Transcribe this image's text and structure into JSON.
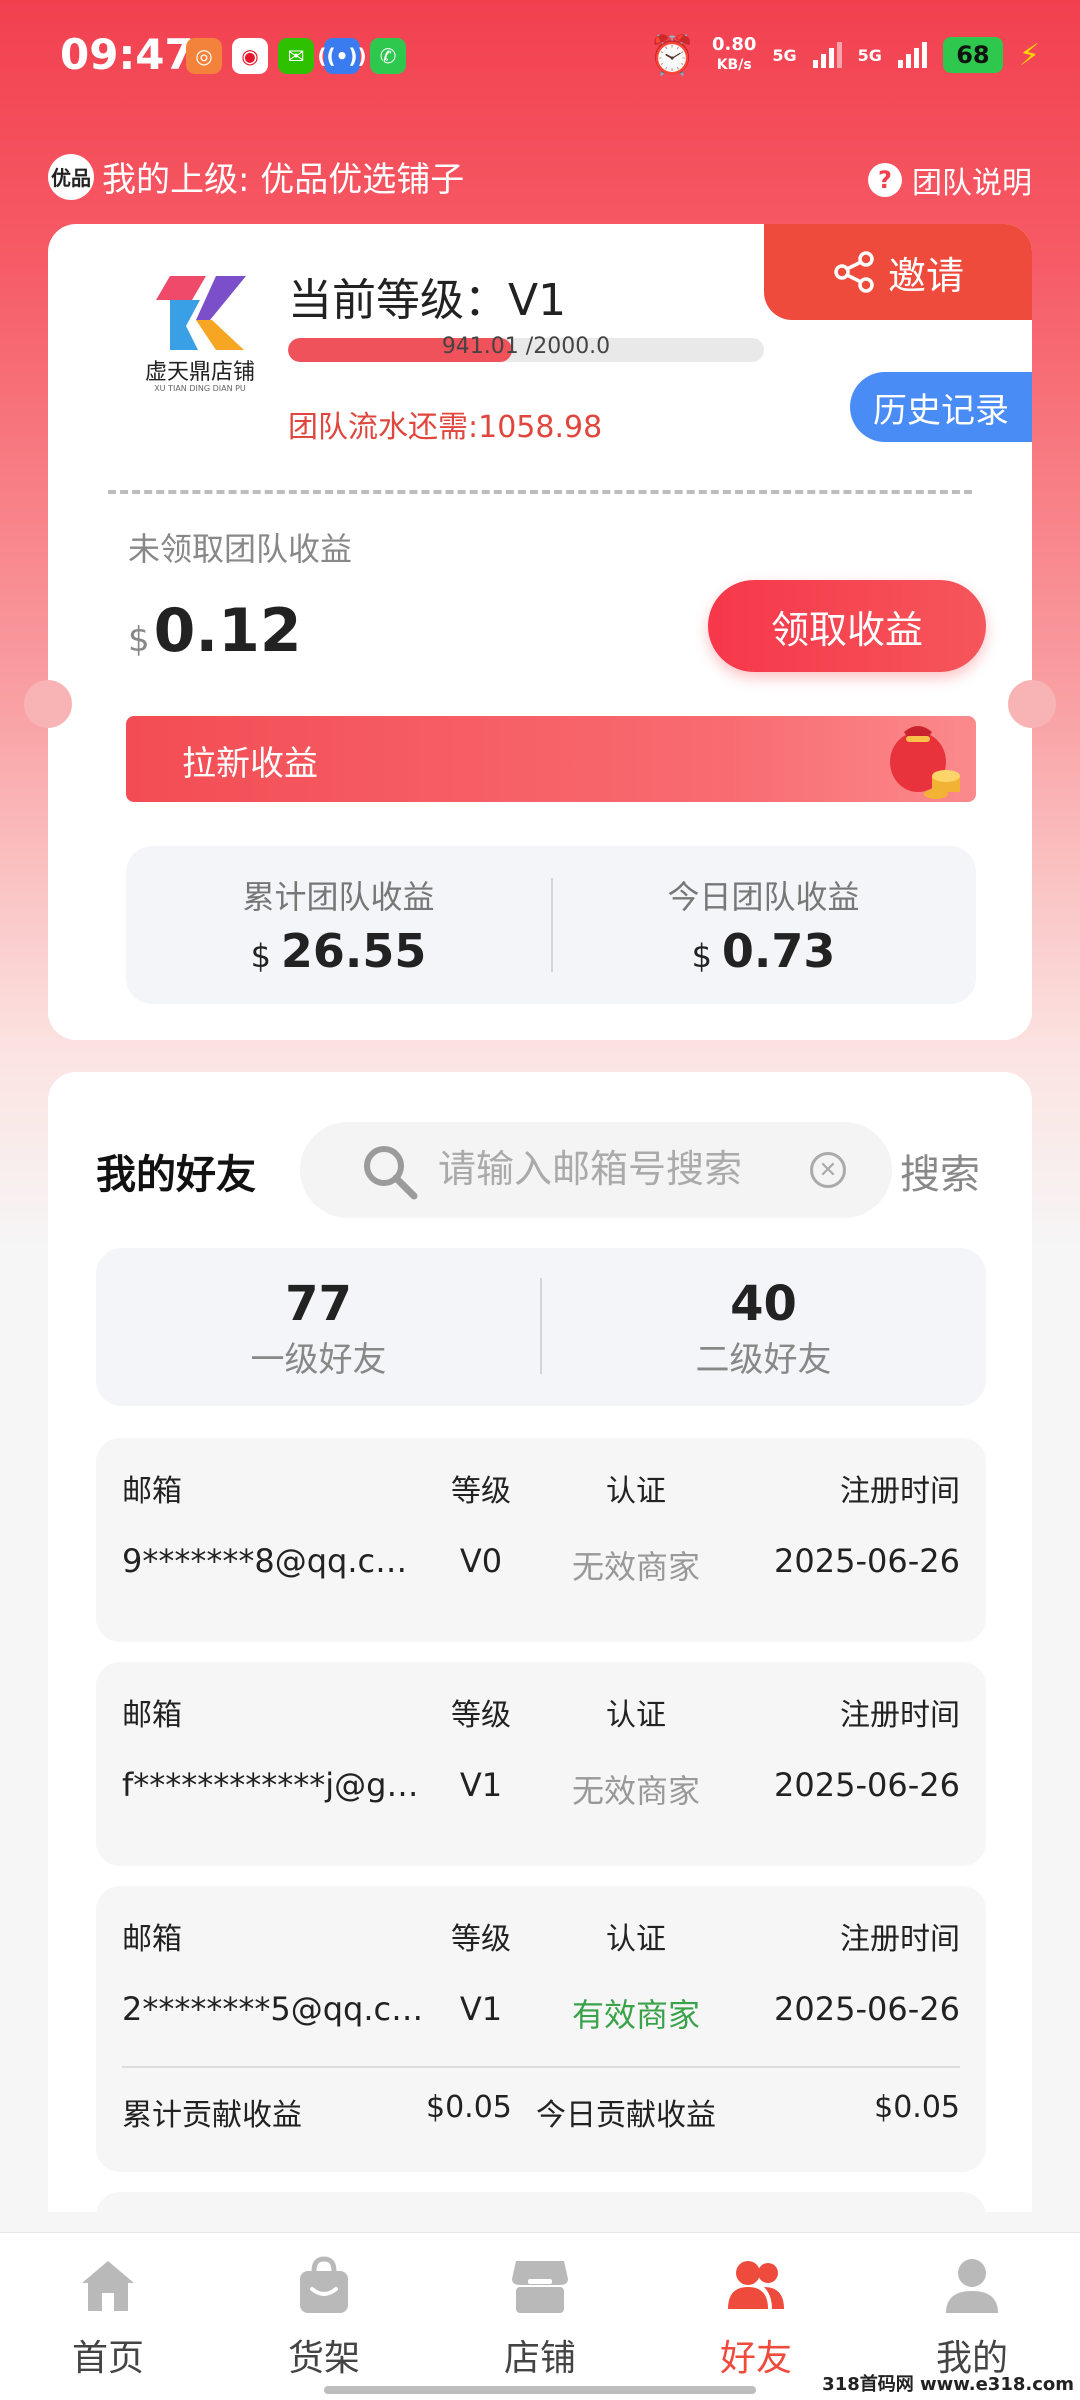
{
  "status_bar": {
    "time": "09:47",
    "net_speed_value": "0.80",
    "net_speed_unit": "KB/s",
    "signal1": "5G",
    "signal2": "5G",
    "battery": "68"
  },
  "header": {
    "superior_logo": "优品",
    "superior_text": "我的上级: 优品优选铺子",
    "team_help": "团队说明"
  },
  "level_card": {
    "logo_name": "虚天鼎店铺",
    "logo_pinyin": "XU TIAN DING DIAN PU",
    "level_title": "当前等级：V1",
    "progress_text": "941.01 /2000.0",
    "progress_fraction": 0.4705,
    "team_flow": "团队流水还需:1058.98",
    "invite_label": "邀请",
    "history_label": "历史记录",
    "unclaimed_label": "未领取团队收益",
    "unclaimed_currency": "$",
    "unclaimed_value": "0.12",
    "claim_label": "领取收益",
    "newbie_label": "拉新收益",
    "total_label": "累计团队收益",
    "total_currency": "$",
    "total_value": "26.55",
    "today_label": "今日团队收益",
    "today_currency": "$",
    "today_value": "0.73"
  },
  "friends": {
    "title": "我的好友",
    "search_placeholder": "请输入邮箱号搜索",
    "search_label": "搜索",
    "level1_count": "77",
    "level1_label": "一级好友",
    "level2_count": "40",
    "level2_label": "二级好友",
    "headers": {
      "mail": "邮箱",
      "level": "等级",
      "auth": "认证",
      "date": "注册时间"
    },
    "records": [
      {
        "mail": "9*******8@qq.c…",
        "level": "V0",
        "auth": "无效商家",
        "date": "2025-06-26"
      },
      {
        "mail": "f************j@g…",
        "level": "V1",
        "auth": "无效商家",
        "date": "2025-06-26"
      },
      {
        "mail": "2********5@qq.c…",
        "level": "V1",
        "auth": "有效商家",
        "date": "2025-06-26",
        "total_contrib_label": "累计贡献收益",
        "total_contrib": "$0.05",
        "today_contrib_label": "今日贡献收益",
        "today_contrib": "$0.05"
      }
    ]
  },
  "nav": {
    "items": [
      {
        "label": "首页",
        "icon": "home-icon"
      },
      {
        "label": "货架",
        "icon": "bag-icon"
      },
      {
        "label": "店铺",
        "icon": "store-icon"
      },
      {
        "label": "好友",
        "icon": "friends-icon"
      },
      {
        "label": "我的",
        "icon": "profile-icon"
      }
    ],
    "active_index": 3
  },
  "watermark": "318首码网 www.e318.com",
  "colors": {
    "primary_red": "#ee4b3c",
    "history_blue": "#4a8cf5",
    "valid_green": "#3aa34a"
  }
}
